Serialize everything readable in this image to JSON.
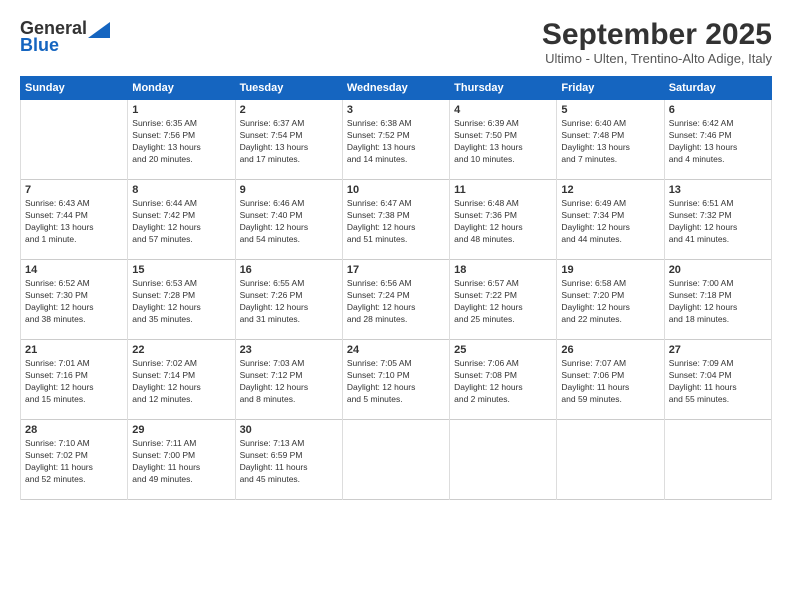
{
  "header": {
    "logo_line1": "General",
    "logo_line2": "Blue",
    "title": "September 2025",
    "subtitle": "Ultimo - Ulten, Trentino-Alto Adige, Italy"
  },
  "weekdays": [
    "Sunday",
    "Monday",
    "Tuesday",
    "Wednesday",
    "Thursday",
    "Friday",
    "Saturday"
  ],
  "weeks": [
    [
      {
        "day": "",
        "info": ""
      },
      {
        "day": "1",
        "info": "Sunrise: 6:35 AM\nSunset: 7:56 PM\nDaylight: 13 hours\nand 20 minutes."
      },
      {
        "day": "2",
        "info": "Sunrise: 6:37 AM\nSunset: 7:54 PM\nDaylight: 13 hours\nand 17 minutes."
      },
      {
        "day": "3",
        "info": "Sunrise: 6:38 AM\nSunset: 7:52 PM\nDaylight: 13 hours\nand 14 minutes."
      },
      {
        "day": "4",
        "info": "Sunrise: 6:39 AM\nSunset: 7:50 PM\nDaylight: 13 hours\nand 10 minutes."
      },
      {
        "day": "5",
        "info": "Sunrise: 6:40 AM\nSunset: 7:48 PM\nDaylight: 13 hours\nand 7 minutes."
      },
      {
        "day": "6",
        "info": "Sunrise: 6:42 AM\nSunset: 7:46 PM\nDaylight: 13 hours\nand 4 minutes."
      }
    ],
    [
      {
        "day": "7",
        "info": "Sunrise: 6:43 AM\nSunset: 7:44 PM\nDaylight: 13 hours\nand 1 minute."
      },
      {
        "day": "8",
        "info": "Sunrise: 6:44 AM\nSunset: 7:42 PM\nDaylight: 12 hours\nand 57 minutes."
      },
      {
        "day": "9",
        "info": "Sunrise: 6:46 AM\nSunset: 7:40 PM\nDaylight: 12 hours\nand 54 minutes."
      },
      {
        "day": "10",
        "info": "Sunrise: 6:47 AM\nSunset: 7:38 PM\nDaylight: 12 hours\nand 51 minutes."
      },
      {
        "day": "11",
        "info": "Sunrise: 6:48 AM\nSunset: 7:36 PM\nDaylight: 12 hours\nand 48 minutes."
      },
      {
        "day": "12",
        "info": "Sunrise: 6:49 AM\nSunset: 7:34 PM\nDaylight: 12 hours\nand 44 minutes."
      },
      {
        "day": "13",
        "info": "Sunrise: 6:51 AM\nSunset: 7:32 PM\nDaylight: 12 hours\nand 41 minutes."
      }
    ],
    [
      {
        "day": "14",
        "info": "Sunrise: 6:52 AM\nSunset: 7:30 PM\nDaylight: 12 hours\nand 38 minutes."
      },
      {
        "day": "15",
        "info": "Sunrise: 6:53 AM\nSunset: 7:28 PM\nDaylight: 12 hours\nand 35 minutes."
      },
      {
        "day": "16",
        "info": "Sunrise: 6:55 AM\nSunset: 7:26 PM\nDaylight: 12 hours\nand 31 minutes."
      },
      {
        "day": "17",
        "info": "Sunrise: 6:56 AM\nSunset: 7:24 PM\nDaylight: 12 hours\nand 28 minutes."
      },
      {
        "day": "18",
        "info": "Sunrise: 6:57 AM\nSunset: 7:22 PM\nDaylight: 12 hours\nand 25 minutes."
      },
      {
        "day": "19",
        "info": "Sunrise: 6:58 AM\nSunset: 7:20 PM\nDaylight: 12 hours\nand 22 minutes."
      },
      {
        "day": "20",
        "info": "Sunrise: 7:00 AM\nSunset: 7:18 PM\nDaylight: 12 hours\nand 18 minutes."
      }
    ],
    [
      {
        "day": "21",
        "info": "Sunrise: 7:01 AM\nSunset: 7:16 PM\nDaylight: 12 hours\nand 15 minutes."
      },
      {
        "day": "22",
        "info": "Sunrise: 7:02 AM\nSunset: 7:14 PM\nDaylight: 12 hours\nand 12 minutes."
      },
      {
        "day": "23",
        "info": "Sunrise: 7:03 AM\nSunset: 7:12 PM\nDaylight: 12 hours\nand 8 minutes."
      },
      {
        "day": "24",
        "info": "Sunrise: 7:05 AM\nSunset: 7:10 PM\nDaylight: 12 hours\nand 5 minutes."
      },
      {
        "day": "25",
        "info": "Sunrise: 7:06 AM\nSunset: 7:08 PM\nDaylight: 12 hours\nand 2 minutes."
      },
      {
        "day": "26",
        "info": "Sunrise: 7:07 AM\nSunset: 7:06 PM\nDaylight: 11 hours\nand 59 minutes."
      },
      {
        "day": "27",
        "info": "Sunrise: 7:09 AM\nSunset: 7:04 PM\nDaylight: 11 hours\nand 55 minutes."
      }
    ],
    [
      {
        "day": "28",
        "info": "Sunrise: 7:10 AM\nSunset: 7:02 PM\nDaylight: 11 hours\nand 52 minutes."
      },
      {
        "day": "29",
        "info": "Sunrise: 7:11 AM\nSunset: 7:00 PM\nDaylight: 11 hours\nand 49 minutes."
      },
      {
        "day": "30",
        "info": "Sunrise: 7:13 AM\nSunset: 6:59 PM\nDaylight: 11 hours\nand 45 minutes."
      },
      {
        "day": "",
        "info": ""
      },
      {
        "day": "",
        "info": ""
      },
      {
        "day": "",
        "info": ""
      },
      {
        "day": "",
        "info": ""
      }
    ]
  ]
}
